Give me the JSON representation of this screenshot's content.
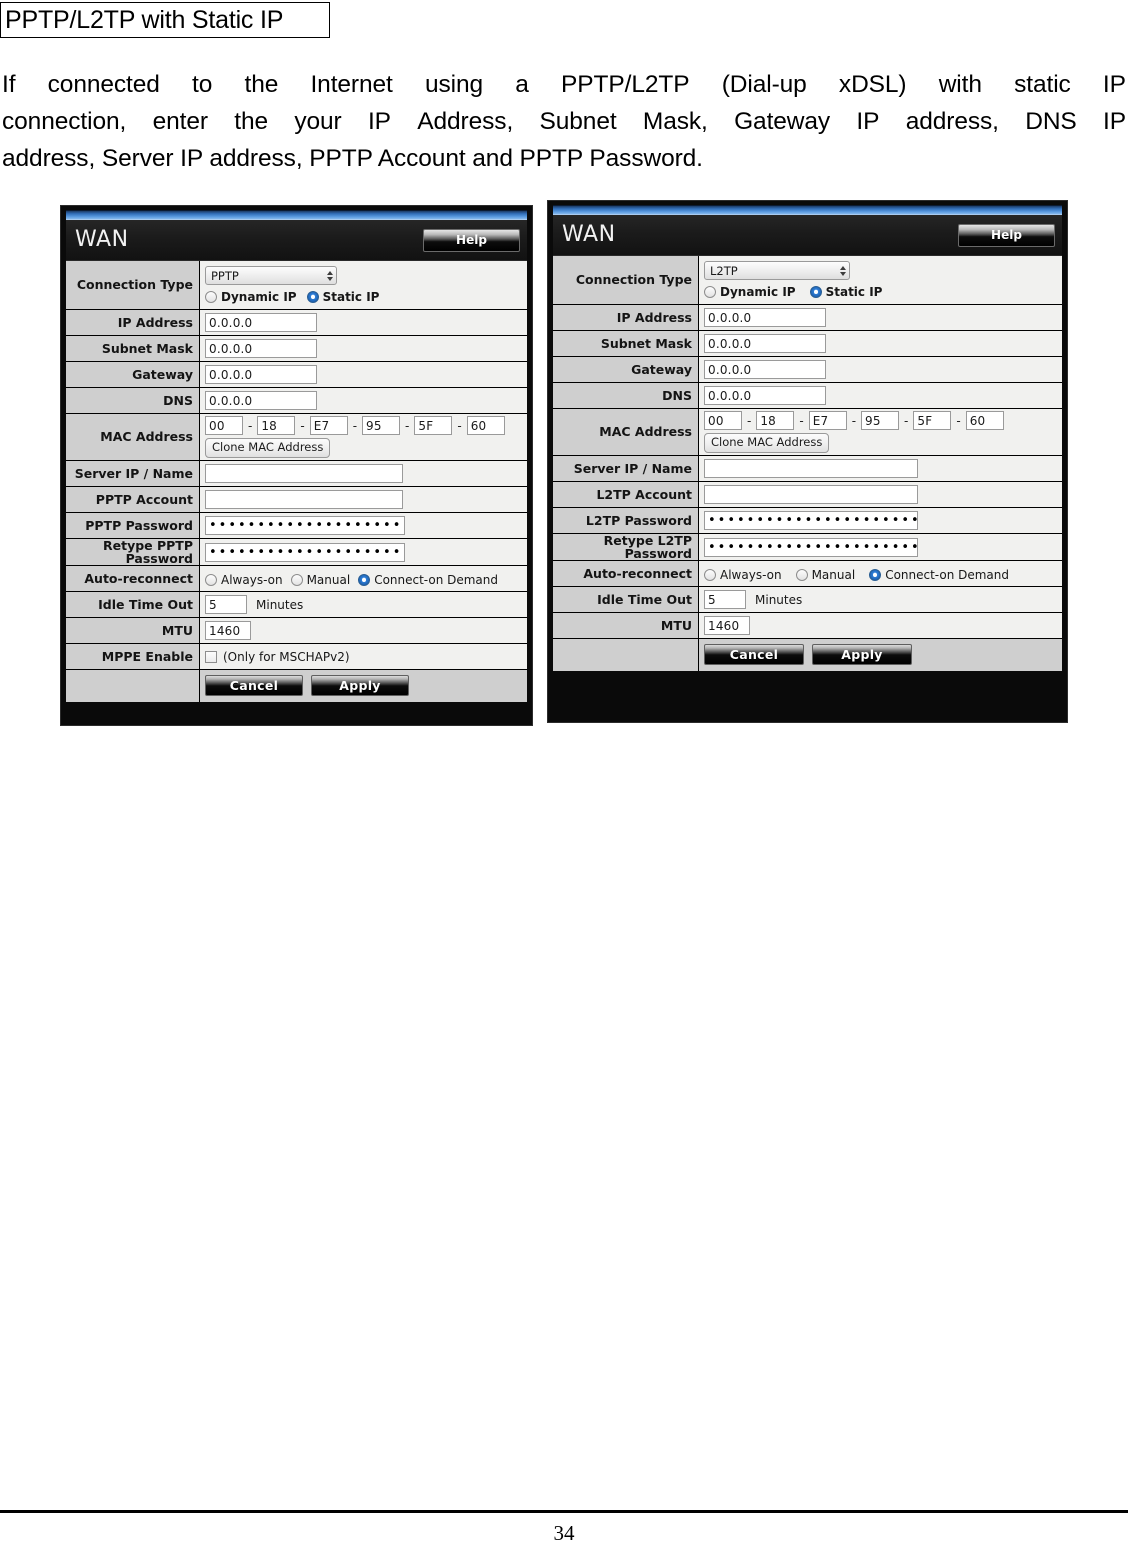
{
  "document": {
    "heading": "PPTP/L2TP with Static IP",
    "paragraph_lines": [
      [
        "If",
        "connected",
        "to",
        "the",
        "Internet",
        "using",
        "a",
        "PPTP/L2TP",
        "(Dial-up",
        "xDSL)",
        "with",
        "static",
        "IP"
      ],
      [
        "connection,",
        "enter",
        "the",
        "your",
        "IP",
        "Address,",
        "Subnet",
        "Mask,",
        "Gateway",
        "IP",
        "address,",
        "DNS",
        "IP"
      ]
    ],
    "paragraph_last_line": "address, Server IP address, PPTP Account and PPTP Password.",
    "page_number": "34"
  },
  "panels": {
    "pptp": {
      "window_title": "WAN",
      "help_label": "Help",
      "rows": {
        "connection_type": {
          "label": "Connection Type",
          "select_value": "PPTP",
          "radios": [
            {
              "label": "Dynamic IP",
              "selected": false
            },
            {
              "label": "Static IP",
              "selected": true
            }
          ]
        },
        "ip_address": {
          "label": "IP Address",
          "value": "0.0.0.0"
        },
        "subnet_mask": {
          "label": "Subnet Mask",
          "value": "0.0.0.0"
        },
        "gateway": {
          "label": "Gateway",
          "value": "0.0.0.0"
        },
        "dns": {
          "label": "DNS",
          "value": "0.0.0.0"
        },
        "mac_address": {
          "label": "MAC Address",
          "octets": [
            "00",
            "18",
            "E7",
            "95",
            "5F",
            "60"
          ],
          "separator": "-",
          "clone_label": "Clone MAC Address"
        },
        "server_ip": {
          "label": "Server IP / Name",
          "value": ""
        },
        "account": {
          "label": "PPTP Account",
          "value": ""
        },
        "password": {
          "label": "PPTP Password",
          "value": "•••••••••••••••••••••••••••••••••"
        },
        "retype": {
          "label": "Retype PPTP Password",
          "value": "•••••••••••••••••••••••••••••••••"
        },
        "auto_reconnect": {
          "label": "Auto-reconnect",
          "radios": [
            {
              "label": "Always-on",
              "selected": false
            },
            {
              "label": "Manual",
              "selected": false
            },
            {
              "label": "Connect-on Demand",
              "selected": true
            }
          ]
        },
        "idle_time_out": {
          "label": "Idle Time Out",
          "value": "5",
          "unit": "Minutes"
        },
        "mtu": {
          "label": "MTU",
          "value": "1460"
        },
        "mppe": {
          "label": "MPPE Enable",
          "checked": false,
          "note": "(Only for MSCHAPv2)"
        }
      },
      "buttons": {
        "cancel": "Cancel",
        "apply": "Apply"
      }
    },
    "l2tp": {
      "window_title": "WAN",
      "help_label": "Help",
      "rows": {
        "connection_type": {
          "label": "Connection Type",
          "select_value": "L2TP",
          "radios": [
            {
              "label": "Dynamic IP",
              "selected": false
            },
            {
              "label": "Static IP",
              "selected": true
            }
          ]
        },
        "ip_address": {
          "label": "IP Address",
          "value": "0.0.0.0"
        },
        "subnet_mask": {
          "label": "Subnet Mask",
          "value": "0.0.0.0"
        },
        "gateway": {
          "label": "Gateway",
          "value": "0.0.0.0"
        },
        "dns": {
          "label": "DNS",
          "value": "0.0.0.0"
        },
        "mac_address": {
          "label": "MAC Address",
          "octets": [
            "00",
            "18",
            "E7",
            "95",
            "5F",
            "60"
          ],
          "separator": "-",
          "clone_label": "Clone MAC Address"
        },
        "server_ip": {
          "label": "Server IP / Name",
          "value": ""
        },
        "account": {
          "label": "L2TP Account",
          "value": ""
        },
        "password": {
          "label": "L2TP Password",
          "value": "•••••••••••••••••••••••••••••••••••"
        },
        "retype": {
          "label": "Retype L2TP Password",
          "value": "•••••••••••••••••••••••••••••••••••"
        },
        "auto_reconnect": {
          "label": "Auto-reconnect",
          "radios": [
            {
              "label": "Always-on",
              "selected": false
            },
            {
              "label": "Manual",
              "selected": false
            },
            {
              "label": "Connect-on Demand",
              "selected": true
            }
          ]
        },
        "idle_time_out": {
          "label": "Idle Time Out",
          "value": "5",
          "unit": "Minutes"
        },
        "mtu": {
          "label": "MTU",
          "value": "1460"
        }
      },
      "buttons": {
        "cancel": "Cancel",
        "apply": "Apply"
      }
    }
  },
  "colors": {
    "accent_blue": "#2f7fd8",
    "label_grey": "#cfcfcf",
    "field_bg": "#f1f1ef",
    "panel_black": "#0a0a0a"
  }
}
